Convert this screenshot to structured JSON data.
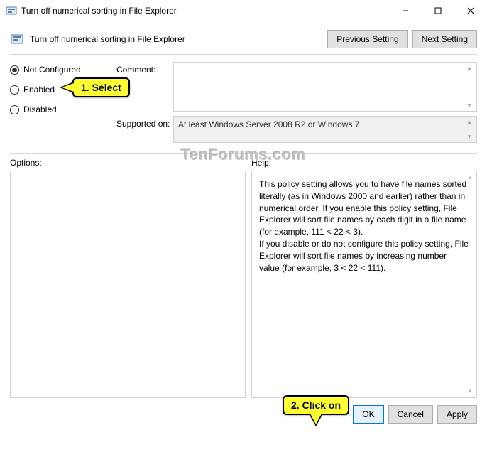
{
  "titlebar": {
    "title": "Turn off numerical sorting in File Explorer"
  },
  "header": {
    "title": "Turn off numerical sorting in File Explorer"
  },
  "nav": {
    "previous": "Previous Setting",
    "next": "Next Setting"
  },
  "radio": {
    "not_configured": "Not Configured",
    "enabled": "Enabled",
    "disabled": "Disabled",
    "selected": "not_configured"
  },
  "fields": {
    "comment_label": "Comment:",
    "comment_value": "",
    "supported_label": "Supported on:",
    "supported_value": "At least Windows Server 2008 R2 or Windows 7"
  },
  "labels": {
    "options": "Options:",
    "help": "Help:"
  },
  "help_text": "This policy setting allows you to have file names sorted literally (as in Windows 2000 and earlier) rather than in numerical order. If you enable this policy setting, File Explorer will sort file names by each digit in a file name (for example, 111 < 22 < 3).\nIf you disable or do not configure this policy setting, File Explorer will sort file names by increasing number value (for example, 3 < 22 < 111).",
  "footer": {
    "ok": "OK",
    "cancel": "Cancel",
    "apply": "Apply"
  },
  "callouts": {
    "select": "1. Select",
    "click": "2. Click on"
  },
  "watermark": "TenForums.com"
}
